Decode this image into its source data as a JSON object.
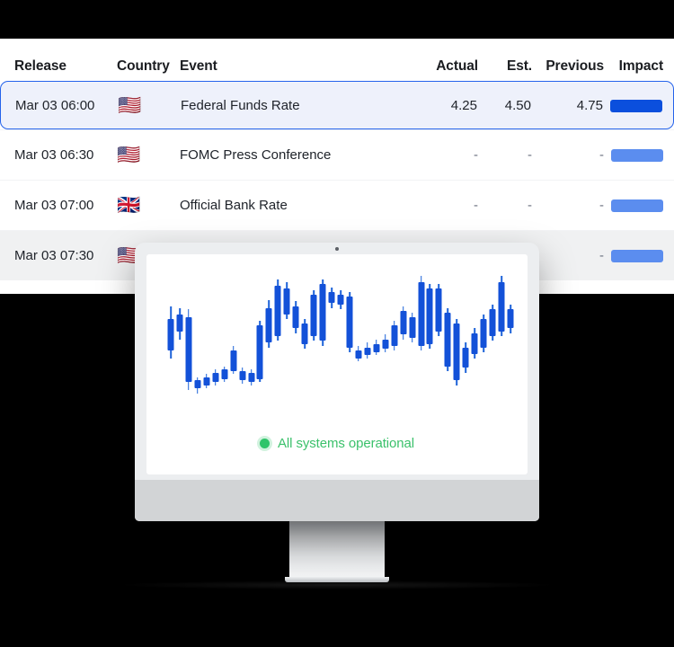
{
  "calendar": {
    "columns": {
      "release": "Release",
      "country": "Country",
      "event": "Event",
      "actual": "Actual",
      "estimate": "Est.",
      "previous": "Previous",
      "impact": "Impact"
    },
    "rows": [
      {
        "release": "Mar 03 06:00",
        "flag": "🇺🇸",
        "country_name": "United States",
        "event": "Federal Funds Rate",
        "actual": "4.25",
        "estimate": "4.50",
        "previous": "4.75",
        "impact": "high",
        "selected": true
      },
      {
        "release": "Mar 03 06:30",
        "flag": "🇺🇸",
        "country_name": "United States",
        "event": "FOMC Press Conference",
        "actual": "-",
        "estimate": "-",
        "previous": "-",
        "impact": "medium",
        "selected": false
      },
      {
        "release": "Mar 03 07:00",
        "flag": "🇬🇧",
        "country_name": "United Kingdom",
        "event": "Official Bank Rate",
        "actual": "-",
        "estimate": "-",
        "previous": "-",
        "impact": "medium",
        "selected": false
      },
      {
        "release": "Mar 03 07:30",
        "flag": "🇺🇸",
        "country_name": "United States",
        "event": "",
        "actual": "",
        "estimate": "",
        "previous": "-",
        "impact": "medium",
        "selected": false
      }
    ]
  },
  "monitor": {
    "status_text": "All systems operational",
    "status_color": "#34c46d"
  },
  "colors": {
    "accent_blue": "#1351d8",
    "impact_high": "#0b4fdd",
    "impact_medium": "#5b8def",
    "selected_row_bg": "#eef1fb",
    "selected_row_border": "#2563eb",
    "status_green": "#2fc46a",
    "background": "#000000",
    "panel_white": "#ffffff"
  },
  "chart_data": {
    "type": "candlestick",
    "title": "",
    "xlabel": "",
    "ylabel": "",
    "up_color": "#1351d8",
    "down_color": "#1351d8",
    "grid": false,
    "ylim": [
      0,
      100
    ],
    "candles": [
      {
        "i": 1,
        "open": 46,
        "close": 66,
        "high": 74,
        "low": 41
      },
      {
        "i": 2,
        "open": 58,
        "close": 69,
        "high": 73,
        "low": 53
      },
      {
        "i": 3,
        "open": 26,
        "close": 67,
        "high": 72,
        "low": 21
      },
      {
        "i": 4,
        "open": 22,
        "close": 27,
        "high": 29,
        "low": 19
      },
      {
        "i": 5,
        "open": 24,
        "close": 29,
        "high": 31,
        "low": 22
      },
      {
        "i": 6,
        "open": 26,
        "close": 32,
        "high": 34,
        "low": 24
      },
      {
        "i": 7,
        "open": 28,
        "close": 34,
        "high": 36,
        "low": 26
      },
      {
        "i": 8,
        "open": 33,
        "close": 46,
        "high": 49,
        "low": 31
      },
      {
        "i": 9,
        "open": 27,
        "close": 33,
        "high": 35,
        "low": 25
      },
      {
        "i": 10,
        "open": 26,
        "close": 32,
        "high": 34,
        "low": 24
      },
      {
        "i": 11,
        "open": 28,
        "close": 62,
        "high": 65,
        "low": 26
      },
      {
        "i": 12,
        "open": 51,
        "close": 73,
        "high": 78,
        "low": 48
      },
      {
        "i": 13,
        "open": 55,
        "close": 87,
        "high": 91,
        "low": 52
      },
      {
        "i": 14,
        "open": 69,
        "close": 85,
        "high": 89,
        "low": 66
      },
      {
        "i": 15,
        "open": 60,
        "close": 74,
        "high": 77,
        "low": 57
      },
      {
        "i": 16,
        "open": 50,
        "close": 63,
        "high": 66,
        "low": 47
      },
      {
        "i": 17,
        "open": 55,
        "close": 81,
        "high": 84,
        "low": 52
      },
      {
        "i": 18,
        "open": 52,
        "close": 88,
        "high": 91,
        "low": 49
      },
      {
        "i": 19,
        "open": 76,
        "close": 83,
        "high": 86,
        "low": 73
      },
      {
        "i": 20,
        "open": 75,
        "close": 81,
        "high": 84,
        "low": 72
      },
      {
        "i": 21,
        "open": 48,
        "close": 80,
        "high": 83,
        "low": 45
      },
      {
        "i": 22,
        "open": 41,
        "close": 46,
        "high": 49,
        "low": 39
      },
      {
        "i": 23,
        "open": 43,
        "close": 48,
        "high": 51,
        "low": 41
      },
      {
        "i": 24,
        "open": 45,
        "close": 50,
        "high": 53,
        "low": 43
      },
      {
        "i": 25,
        "open": 47,
        "close": 53,
        "high": 56,
        "low": 45
      },
      {
        "i": 26,
        "open": 49,
        "close": 62,
        "high": 65,
        "low": 46
      },
      {
        "i": 27,
        "open": 56,
        "close": 71,
        "high": 74,
        "low": 53
      },
      {
        "i": 28,
        "open": 54,
        "close": 67,
        "high": 70,
        "low": 51
      },
      {
        "i": 29,
        "open": 49,
        "close": 89,
        "high": 93,
        "low": 46
      },
      {
        "i": 30,
        "open": 50,
        "close": 85,
        "high": 88,
        "low": 47
      },
      {
        "i": 31,
        "open": 58,
        "close": 85,
        "high": 88,
        "low": 55
      },
      {
        "i": 32,
        "open": 36,
        "close": 70,
        "high": 73,
        "low": 33
      },
      {
        "i": 33,
        "open": 27,
        "close": 63,
        "high": 66,
        "low": 24
      },
      {
        "i": 34,
        "open": 35,
        "close": 48,
        "high": 51,
        "low": 32
      },
      {
        "i": 35,
        "open": 44,
        "close": 57,
        "high": 60,
        "low": 41
      },
      {
        "i": 36,
        "open": 48,
        "close": 66,
        "high": 69,
        "low": 45
      },
      {
        "i": 37,
        "open": 55,
        "close": 72,
        "high": 75,
        "low": 52
      },
      {
        "i": 38,
        "open": 58,
        "close": 89,
        "high": 93,
        "low": 55
      },
      {
        "i": 39,
        "open": 60,
        "close": 72,
        "high": 75,
        "low": 57
      }
    ]
  }
}
